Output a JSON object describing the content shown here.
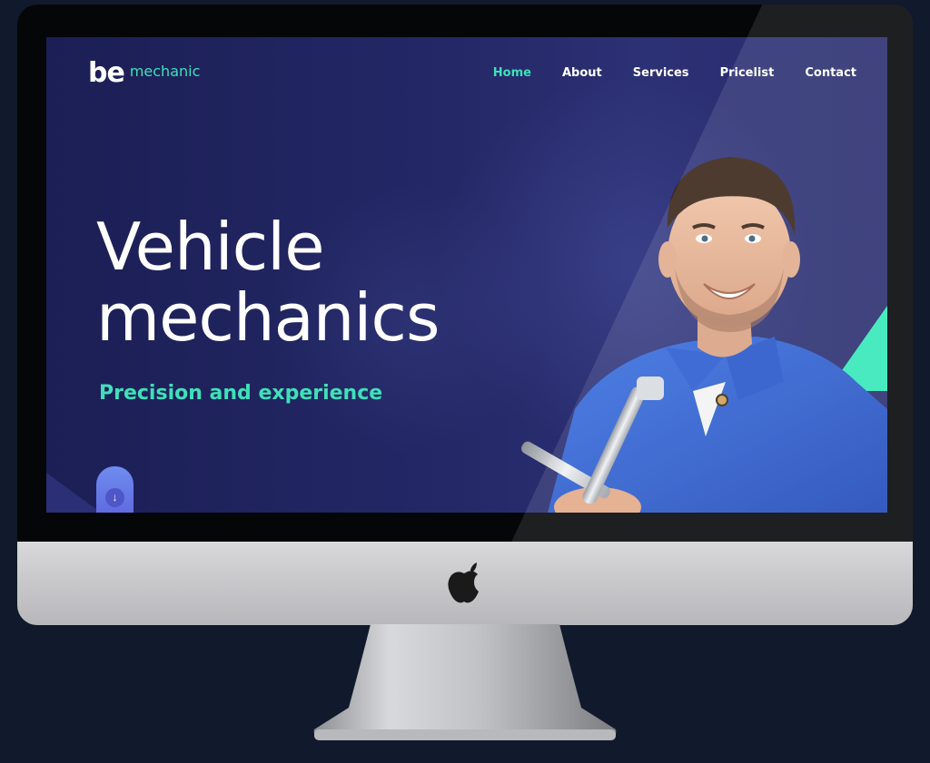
{
  "brand": {
    "be": "be",
    "mechanic": "mechanic"
  },
  "nav": {
    "items": [
      {
        "label": "Home",
        "active": true
      },
      {
        "label": "About",
        "active": false
      },
      {
        "label": "Services",
        "active": false
      },
      {
        "label": "Pricelist",
        "active": false
      },
      {
        "label": "Contact",
        "active": false
      }
    ]
  },
  "hero": {
    "title_line1": "Vehicle",
    "title_line2": "mechanics",
    "subtitle": "Precision and experience",
    "scroll_icon": "arrow-down-icon"
  },
  "colors": {
    "accent": "#3fe0b9",
    "screen_bg": "#232765",
    "page_bg": "#111a2c",
    "uniform": "#2f5fd0"
  },
  "device": {
    "logo_icon": "apple-logo-icon"
  }
}
